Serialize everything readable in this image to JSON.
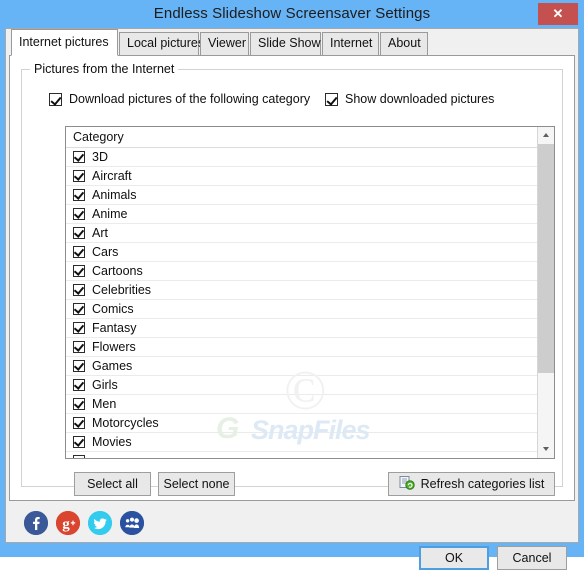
{
  "window": {
    "title": "Endless Slideshow Screensaver Settings",
    "close_label": "✕",
    "titlebar_color": "#66b3f5",
    "close_color": "#c4504f"
  },
  "tabs": [
    {
      "label": "Internet pictures",
      "active": true
    },
    {
      "label": "Local pictures",
      "active": false
    },
    {
      "label": "Viewer",
      "active": false
    },
    {
      "label": "Slide Show",
      "active": false
    },
    {
      "label": "Internet",
      "active": false
    },
    {
      "label": "About",
      "active": false
    }
  ],
  "group": {
    "title": "Pictures from the Internet",
    "download_checkbox": {
      "label": "Download pictures of the following category",
      "checked": true
    },
    "show_checkbox": {
      "label": "Show downloaded pictures",
      "checked": true
    }
  },
  "list": {
    "header": "Category",
    "rows": [
      {
        "label": "3D",
        "checked": true
      },
      {
        "label": "Aircraft",
        "checked": true
      },
      {
        "label": "Animals",
        "checked": true
      },
      {
        "label": "Anime",
        "checked": true
      },
      {
        "label": "Art",
        "checked": true
      },
      {
        "label": "Cars",
        "checked": true
      },
      {
        "label": "Cartoons",
        "checked": true
      },
      {
        "label": "Celebrities",
        "checked": true
      },
      {
        "label": "Comics",
        "checked": true
      },
      {
        "label": "Fantasy",
        "checked": true
      },
      {
        "label": "Flowers",
        "checked": true
      },
      {
        "label": "Games",
        "checked": true
      },
      {
        "label": "Girls",
        "checked": true
      },
      {
        "label": "Men",
        "checked": true
      },
      {
        "label": "Motorcycles",
        "checked": true
      },
      {
        "label": "Movies",
        "checked": true
      }
    ]
  },
  "watermark": {
    "copyright": "©",
    "brand": "SnapFiles",
    "logo": "G"
  },
  "buttons": {
    "select_all": "Select all",
    "select_none": "Select none",
    "refresh": "Refresh categories list",
    "ok": "OK",
    "cancel": "Cancel"
  },
  "social": [
    {
      "name": "facebook",
      "glyph": "f",
      "color": "#3b5998"
    },
    {
      "name": "google-plus",
      "glyph": "g+",
      "color": "#d9452e"
    },
    {
      "name": "twitter",
      "glyph": "•",
      "color": "#33ccee"
    },
    {
      "name": "myspace",
      "glyph": "•",
      "color": "#2b52a0"
    }
  ]
}
